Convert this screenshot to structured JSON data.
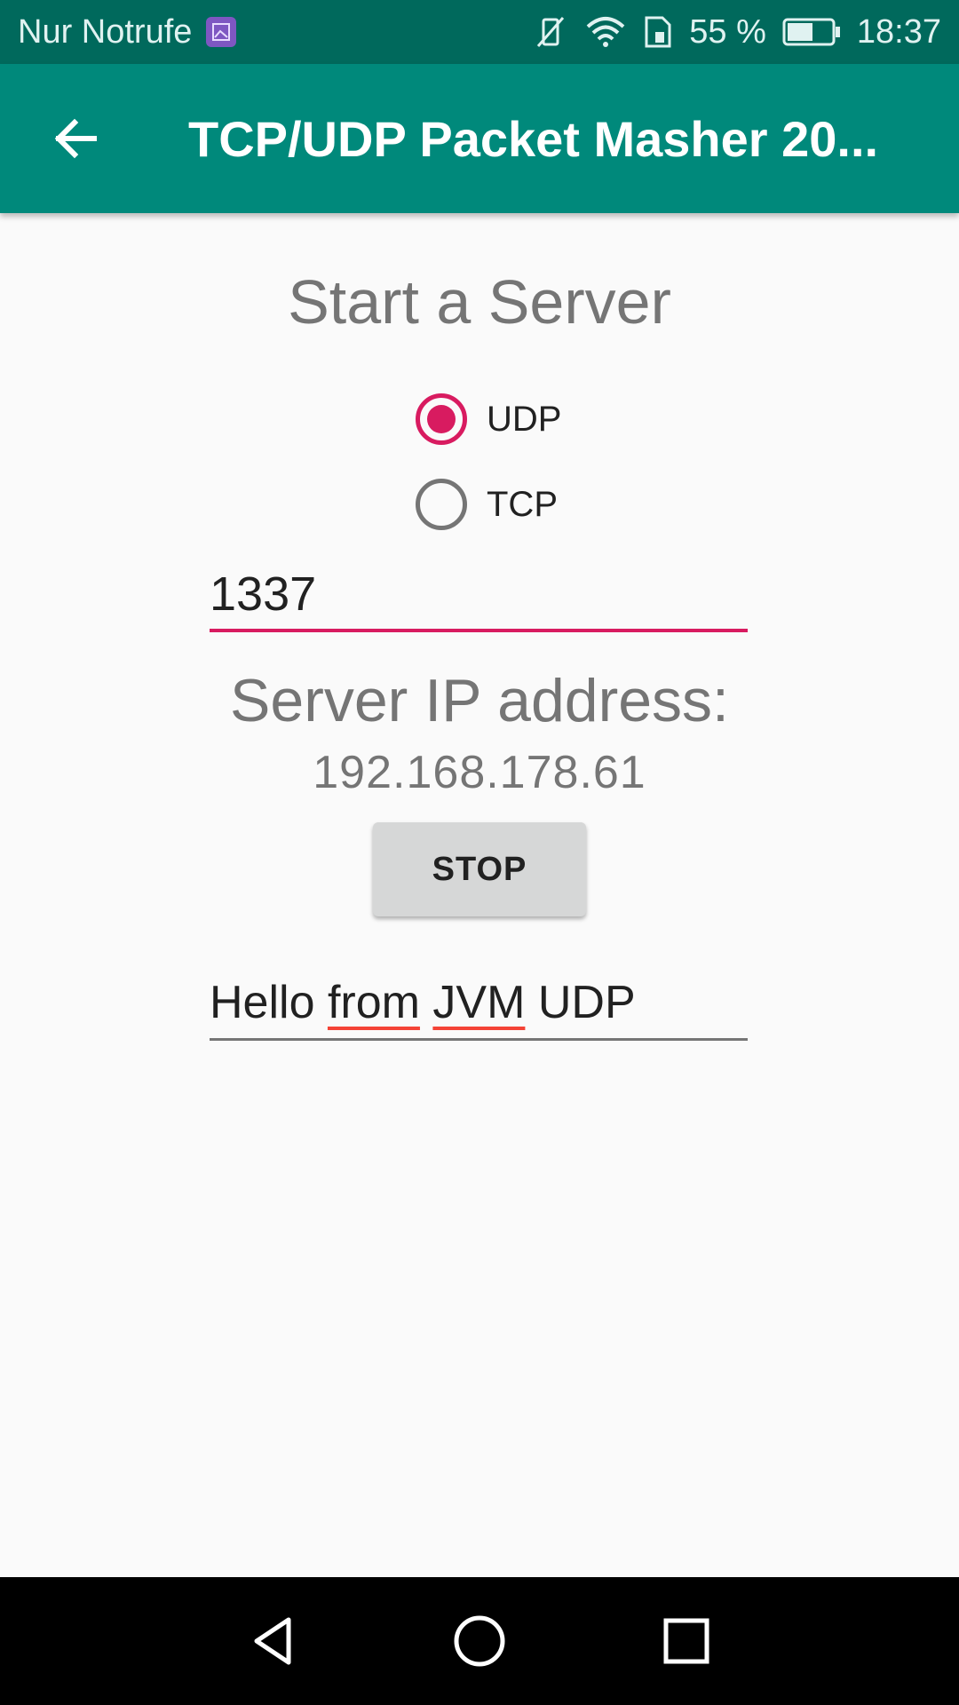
{
  "status_bar": {
    "carrier_text": "Nur Notrufe",
    "battery_percent": "55 %",
    "time": "18:37"
  },
  "app_bar": {
    "title": "TCP/UDP Packet Masher 20..."
  },
  "main": {
    "heading": "Start a Server",
    "protocol_options": [
      {
        "label": "UDP",
        "checked": true
      },
      {
        "label": "TCP",
        "checked": false
      }
    ],
    "port_value": "1337",
    "ip_heading": "Server IP address:",
    "ip_value": "192.168.178.61",
    "stop_label": "STOP",
    "message_words": [
      "Hello",
      "from",
      "JVM",
      "UDP"
    ]
  },
  "colors": {
    "status_bar": "#00695c",
    "app_bar": "#00897b",
    "accent": "#d81b60",
    "nav_bar": "#000000"
  }
}
